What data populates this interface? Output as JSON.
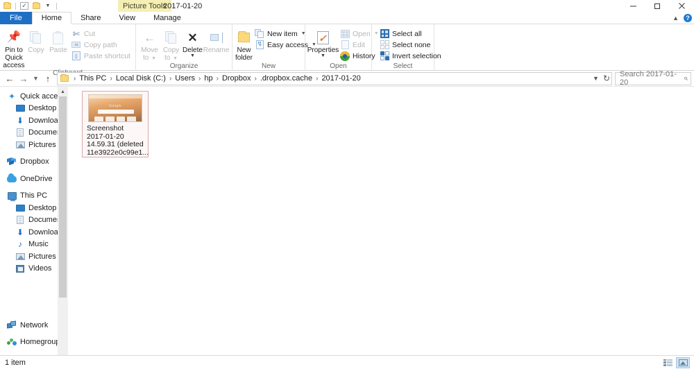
{
  "titlebar": {
    "quick_access": [
      {
        "name": "folder-icon",
        "label": ""
      },
      {
        "name": "properties-check-icon",
        "label": ""
      },
      {
        "name": "new-folder-icon",
        "label": ""
      },
      {
        "name": "customize-qat-caret",
        "label": ""
      }
    ],
    "contextual_tab": "Picture Tools",
    "window_title": "2017-01-20",
    "controls": {
      "minimize": "minimize-icon",
      "restore": "restore-icon",
      "close": "close-icon"
    }
  },
  "tabs": {
    "items": [
      {
        "label": "File",
        "state": "file"
      },
      {
        "label": "Home",
        "state": "active"
      },
      {
        "label": "Share",
        "state": "normal"
      },
      {
        "label": "View",
        "state": "normal"
      },
      {
        "label": "Manage",
        "state": "normal"
      }
    ],
    "collapse_label": "^",
    "help_label": "?"
  },
  "ribbon": {
    "groups": [
      {
        "title": "Clipboard",
        "big": [
          {
            "label_line1": "Pin to Quick",
            "label_line2": "access",
            "enabled": true,
            "icon": "pin-icon"
          },
          {
            "label_line1": "Copy",
            "label_line2": "",
            "enabled": false,
            "icon": "copy-icon"
          },
          {
            "label_line1": "Paste",
            "label_line2": "",
            "enabled": false,
            "icon": "paste-icon"
          }
        ],
        "small": [
          {
            "label": "Cut",
            "enabled": false,
            "icon": "scissors-icon"
          },
          {
            "label": "Copy path",
            "enabled": false,
            "icon": "copy-path-icon"
          },
          {
            "label": "Paste shortcut",
            "enabled": false,
            "icon": "paste-shortcut-icon"
          }
        ]
      },
      {
        "title": "Organize",
        "big": [
          {
            "label_line1": "Move",
            "label_line2": "to",
            "enabled": false,
            "icon": "move-to-icon",
            "dropdown": true
          },
          {
            "label_line1": "Copy",
            "label_line2": "to",
            "enabled": false,
            "icon": "copy-to-icon",
            "dropdown": true
          },
          {
            "label_line1": "Delete",
            "label_line2": "",
            "enabled": true,
            "icon": "delete-icon",
            "subcaret": true
          },
          {
            "label_line1": "Rename",
            "label_line2": "",
            "enabled": false,
            "icon": "rename-icon"
          }
        ],
        "small": []
      },
      {
        "title": "New",
        "big": [
          {
            "label_line1": "New",
            "label_line2": "folder",
            "enabled": true,
            "icon": "new-folder-icon"
          }
        ],
        "small": [
          {
            "label": "New item",
            "enabled": true,
            "icon": "new-item-icon",
            "dropdown": true
          },
          {
            "label": "Easy access",
            "enabled": true,
            "icon": "easy-access-icon",
            "dropdown": true
          }
        ]
      },
      {
        "title": "Open",
        "big": [
          {
            "label_line1": "Properties",
            "label_line2": "",
            "enabled": true,
            "icon": "properties-icon",
            "subcaret": true
          }
        ],
        "small": [
          {
            "label": "Open",
            "enabled": false,
            "icon": "open-icon",
            "dropdown": true
          },
          {
            "label": "Edit",
            "enabled": false,
            "icon": "edit-icon"
          },
          {
            "label": "History",
            "enabled": true,
            "icon": "history-icon"
          }
        ]
      },
      {
        "title": "Select",
        "big": [],
        "small": [
          {
            "label": "Select all",
            "enabled": true,
            "icon": "select-all-icon"
          },
          {
            "label": "Select none",
            "enabled": true,
            "icon": "select-none-icon"
          },
          {
            "label": "Invert selection",
            "enabled": true,
            "icon": "invert-selection-icon"
          }
        ]
      }
    ]
  },
  "addressbar": {
    "back": "back-arrow-icon",
    "forward": "forward-arrow-icon",
    "recent": "recent-locations-icon",
    "up": "up-arrow-icon",
    "breadcrumbs": [
      "This PC",
      "Local Disk (C:)",
      "Users",
      "hp",
      "Dropbox",
      ".dropbox.cache",
      "2017-01-20"
    ],
    "separator": "›",
    "dropdown": "˅",
    "refresh": "↻",
    "search_placeholder": "Search 2017-01-20",
    "search_value": "",
    "search_icon": "⌕"
  },
  "navpane": {
    "sections": [
      {
        "items": [
          {
            "label": "Quick access",
            "icon": "star-pin-icon",
            "indent": false,
            "pinned": false
          },
          {
            "label": "Desktop",
            "icon": "desktop-icon",
            "indent": true,
            "pinned": true
          },
          {
            "label": "Downloads",
            "icon": "downloads-icon",
            "indent": true,
            "pinned": true
          },
          {
            "label": "Documents",
            "icon": "documents-icon",
            "indent": true,
            "pinned": true
          },
          {
            "label": "Pictures",
            "icon": "pictures-icon",
            "indent": true,
            "pinned": true
          }
        ]
      },
      {
        "items": [
          {
            "label": "Dropbox",
            "icon": "dropbox-icon",
            "indent": false,
            "pinned": false
          }
        ]
      },
      {
        "items": [
          {
            "label": "OneDrive",
            "icon": "onedrive-icon",
            "indent": false,
            "pinned": false
          }
        ]
      },
      {
        "items": [
          {
            "label": "This PC",
            "icon": "this-pc-icon",
            "indent": false,
            "pinned": false
          },
          {
            "label": "Desktop",
            "icon": "desktop-icon",
            "indent": true,
            "pinned": false
          },
          {
            "label": "Documents",
            "icon": "documents-icon",
            "indent": true,
            "pinned": false
          },
          {
            "label": "Downloads",
            "icon": "downloads-icon",
            "indent": true,
            "pinned": false
          },
          {
            "label": "Music",
            "icon": "music-icon",
            "indent": true,
            "pinned": false
          },
          {
            "label": "Pictures",
            "icon": "pictures-icon",
            "indent": true,
            "pinned": false
          },
          {
            "label": "Videos",
            "icon": "videos-icon",
            "indent": true,
            "pinned": false
          }
        ]
      }
    ],
    "bottom": [
      {
        "label": "Network",
        "icon": "network-icon"
      },
      {
        "label": "Homegroup",
        "icon": "homegroup-icon"
      }
    ],
    "scroll_up": "˄",
    "scroll_down": "˅"
  },
  "files": [
    {
      "name_lines": [
        "Screenshot",
        "2017-01-20",
        "14.59.31 (deleted",
        "11e3922e0c99e1..."
      ],
      "selected": true,
      "thumbnail_label": "Google"
    }
  ],
  "statusbar": {
    "count_text": "1 item",
    "views": [
      {
        "name": "details-view-button",
        "active": false
      },
      {
        "name": "large-icons-view-button",
        "active": true
      }
    ]
  },
  "colors": {
    "file_tab_blue": "#1e6fc4",
    "contextual_yellow": "#f4efb4",
    "selection_pink": "#d9a9a9",
    "accent_blue": "#2f7fc7"
  }
}
